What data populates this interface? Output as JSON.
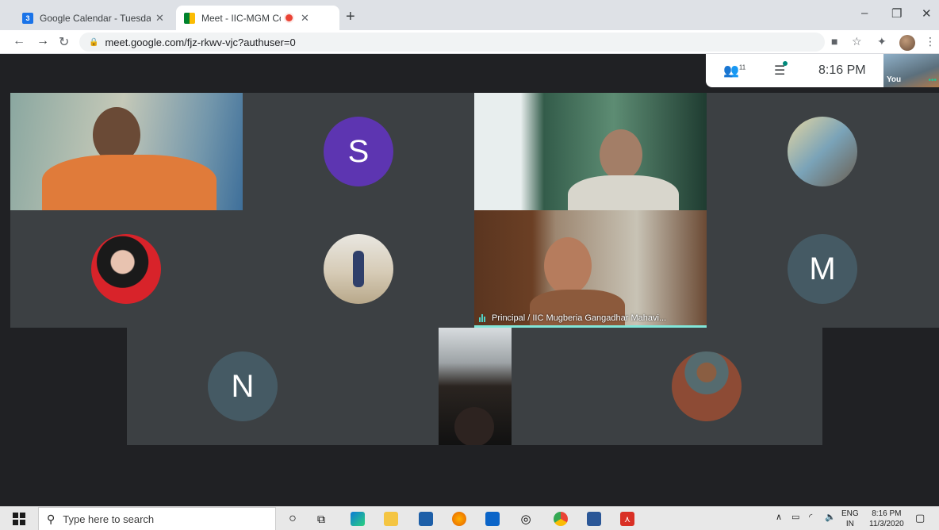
{
  "browser": {
    "tabs": [
      {
        "title": "Google Calendar - Tuesday, Nove",
        "favicon": "3"
      },
      {
        "title": "Meet - IIC-MGM Committee"
      }
    ],
    "new_tab": "+",
    "address": "meet.google.com/fjz-rkwv-vjc?authuser=0"
  },
  "meet": {
    "participant_count": "11",
    "time": "8:16 PM",
    "self_label": "You",
    "tiles": [
      {
        "kind": "video",
        "name": "participant-video-1"
      },
      {
        "kind": "avatar",
        "letter": "S",
        "color": "#5d35b1"
      },
      {
        "kind": "video",
        "name": "participant-video-2"
      },
      {
        "kind": "photo",
        "name": "participant-photo-1"
      },
      {
        "kind": "photo",
        "name": "participant-photo-2"
      },
      {
        "kind": "photo",
        "name": "participant-photo-3"
      },
      {
        "kind": "video",
        "name": "principal-video",
        "caption": "Principal / IIC Mugberia Gangadhar Mahavi..."
      },
      {
        "kind": "avatar",
        "letter": "M",
        "color": "#455a64"
      },
      {
        "kind": "avatar",
        "letter": "N",
        "color": "#455a64"
      },
      {
        "kind": "video",
        "name": "participant-video-3"
      },
      {
        "kind": "photo",
        "name": "participant-photo-4"
      }
    ]
  },
  "taskbar": {
    "search_placeholder": "Type here to search",
    "lang_top": "ENG",
    "lang_bottom": "IN",
    "clock_time": "8:16 PM",
    "clock_date": "11/3/2020"
  }
}
